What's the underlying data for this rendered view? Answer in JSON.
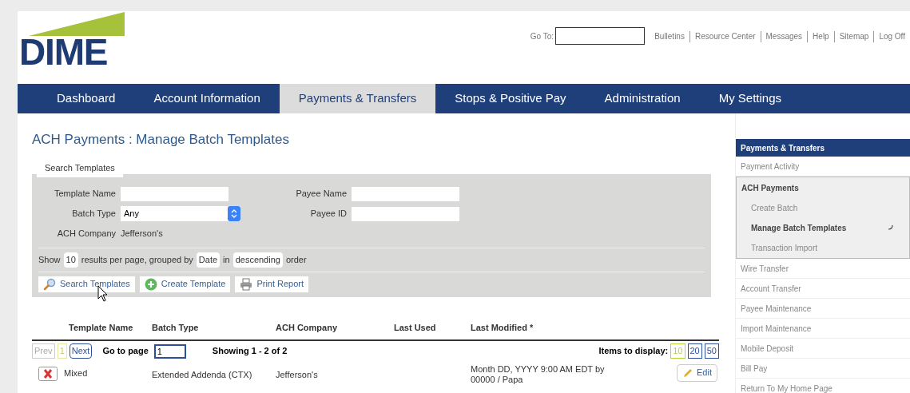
{
  "header": {
    "logo": "DIME",
    "goto_label": "Go To:",
    "links": [
      "Bulletins",
      "Resource Center",
      "Messages",
      "Help",
      "Sitemap",
      "Log Off"
    ]
  },
  "nav": [
    {
      "label": "Dashboard",
      "selected": false
    },
    {
      "label": "Account Information",
      "selected": false
    },
    {
      "label": "Payments & Transfers",
      "selected": true
    },
    {
      "label": "Stops & Positive Pay",
      "selected": false
    },
    {
      "label": "Administration",
      "selected": false
    },
    {
      "label": "My Settings",
      "selected": false
    }
  ],
  "page_title": "ACH Payments : Manage Batch Templates",
  "search": {
    "legend": "Search Templates",
    "fields_left": [
      {
        "label": "Template Name",
        "kind": "text"
      },
      {
        "label": "Batch Type",
        "kind": "select",
        "value": "Any"
      },
      {
        "label": "ACH Company",
        "kind": "static",
        "value": "Jefferson's"
      }
    ],
    "fields_right": [
      {
        "label": "Payee Name",
        "kind": "text"
      },
      {
        "label": "Payee ID",
        "kind": "text"
      }
    ],
    "options": [
      {
        "kind": "text",
        "text": "Show"
      },
      {
        "kind": "select",
        "text": "10"
      },
      {
        "kind": "text",
        "text": "results per page, grouped by"
      },
      {
        "kind": "select",
        "text": "Date"
      },
      {
        "kind": "text",
        "text": "in"
      },
      {
        "kind": "select",
        "text": "descending"
      },
      {
        "kind": "text",
        "text": "order"
      }
    ],
    "buttons": [
      {
        "label": "Search Templates"
      },
      {
        "label": "Create Template"
      },
      {
        "label": "Print Report"
      }
    ]
  },
  "table": {
    "columns": [
      "Template Name",
      "Batch Type",
      "ACH Company",
      "Last Used",
      "Last Modified *"
    ],
    "pagination": {
      "prev": "Prev",
      "pages": [
        {
          "label": "1",
          "selected": true
        }
      ],
      "next": "Next",
      "goto_label": "Go to page",
      "goto_value": "1",
      "showing": "Showing 1 - 2 of 2",
      "items_label": "Items to display:",
      "sizes": [
        {
          "label": "10",
          "selected": true
        },
        {
          "label": "20",
          "selected": false
        },
        {
          "label": "50",
          "selected": false
        }
      ]
    },
    "rows": [
      {
        "name": "Mixed",
        "batch_type": "Extended Addenda (CTX)",
        "company": "Jefferson's",
        "last_modified": "Month DD, YYYY 9:00 AM EDT by 00000 / Papa",
        "action": "Edit"
      }
    ]
  },
  "sidebar": {
    "title": "Payments & Transfers",
    "items": [
      {
        "label": "Payment Activity"
      },
      {
        "label": "ACH Payments",
        "children": [
          {
            "label": "Create Batch",
            "selected": false
          },
          {
            "label": "Manage Batch Templates",
            "selected": true
          },
          {
            "label": "Transaction Import",
            "selected": false
          }
        ]
      },
      {
        "label": "Wire Transfer"
      },
      {
        "label": "Account Transfer"
      },
      {
        "label": "Payee Maintenance"
      },
      {
        "label": "Import Maintenance"
      },
      {
        "label": "Mobile Deposit"
      },
      {
        "label": "Bill Pay"
      },
      {
        "label": "Return To My Home Page"
      }
    ]
  }
}
